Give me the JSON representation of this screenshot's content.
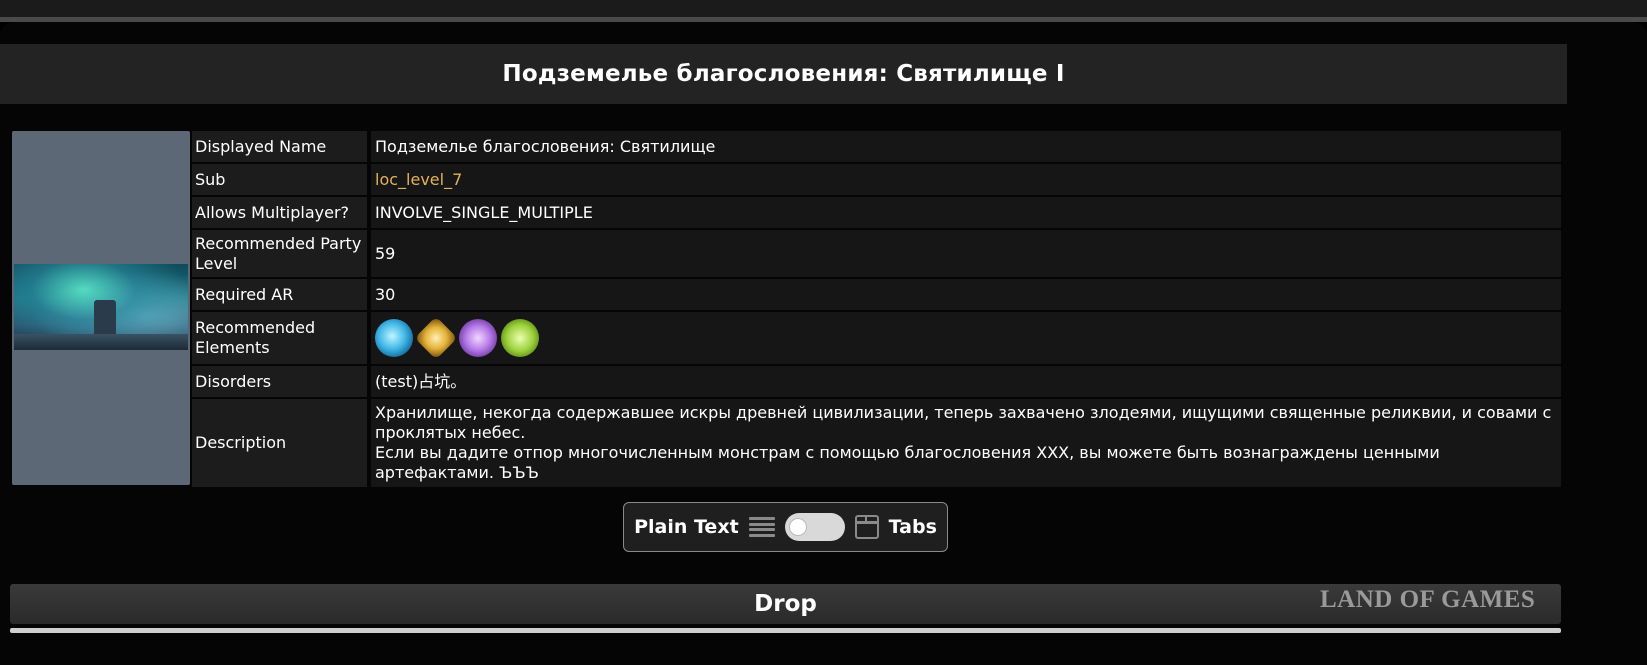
{
  "page": {
    "title": "Подземелье благословения: Святилище I"
  },
  "info": {
    "rows": [
      {
        "label": "Displayed Name",
        "value": "Подземелье благословения: Святилище"
      },
      {
        "label": "Sub",
        "value": "loc_level_7"
      },
      {
        "label": "Allows Multiplayer?",
        "value": "INVOLVE_SINGLE_MULTIPLE"
      },
      {
        "label": "Recommended Party Level",
        "value": "59"
      },
      {
        "label": "Required AR",
        "value": "30"
      },
      {
        "label": "Recommended Elements",
        "value": ""
      },
      {
        "label": "Disorders",
        "value": "(test)占坑。"
      },
      {
        "label": "Description",
        "value": ""
      }
    ],
    "elements": [
      "hydro-icon",
      "geo-icon",
      "electro-icon",
      "dendro-icon"
    ],
    "description_lines": [
      "Хранилище, некогда содержавшее искры древней цивилизации, теперь захвачено злодеями, ищущими священные реликвии, и совами с проклятых небес.",
      "Если вы дадите отпор многочисленным монстрам с помощью благословения XXX, вы можете быть вознаграждены ценными артефактами. ЪЪЪ"
    ]
  },
  "view_toggle": {
    "left_label": "Plain Text",
    "right_label": "Tabs",
    "state": "off"
  },
  "drop": {
    "title": "Drop"
  },
  "watermark": "LAND OF GAMES",
  "colors": {
    "sub_link": "#e3b15a"
  }
}
